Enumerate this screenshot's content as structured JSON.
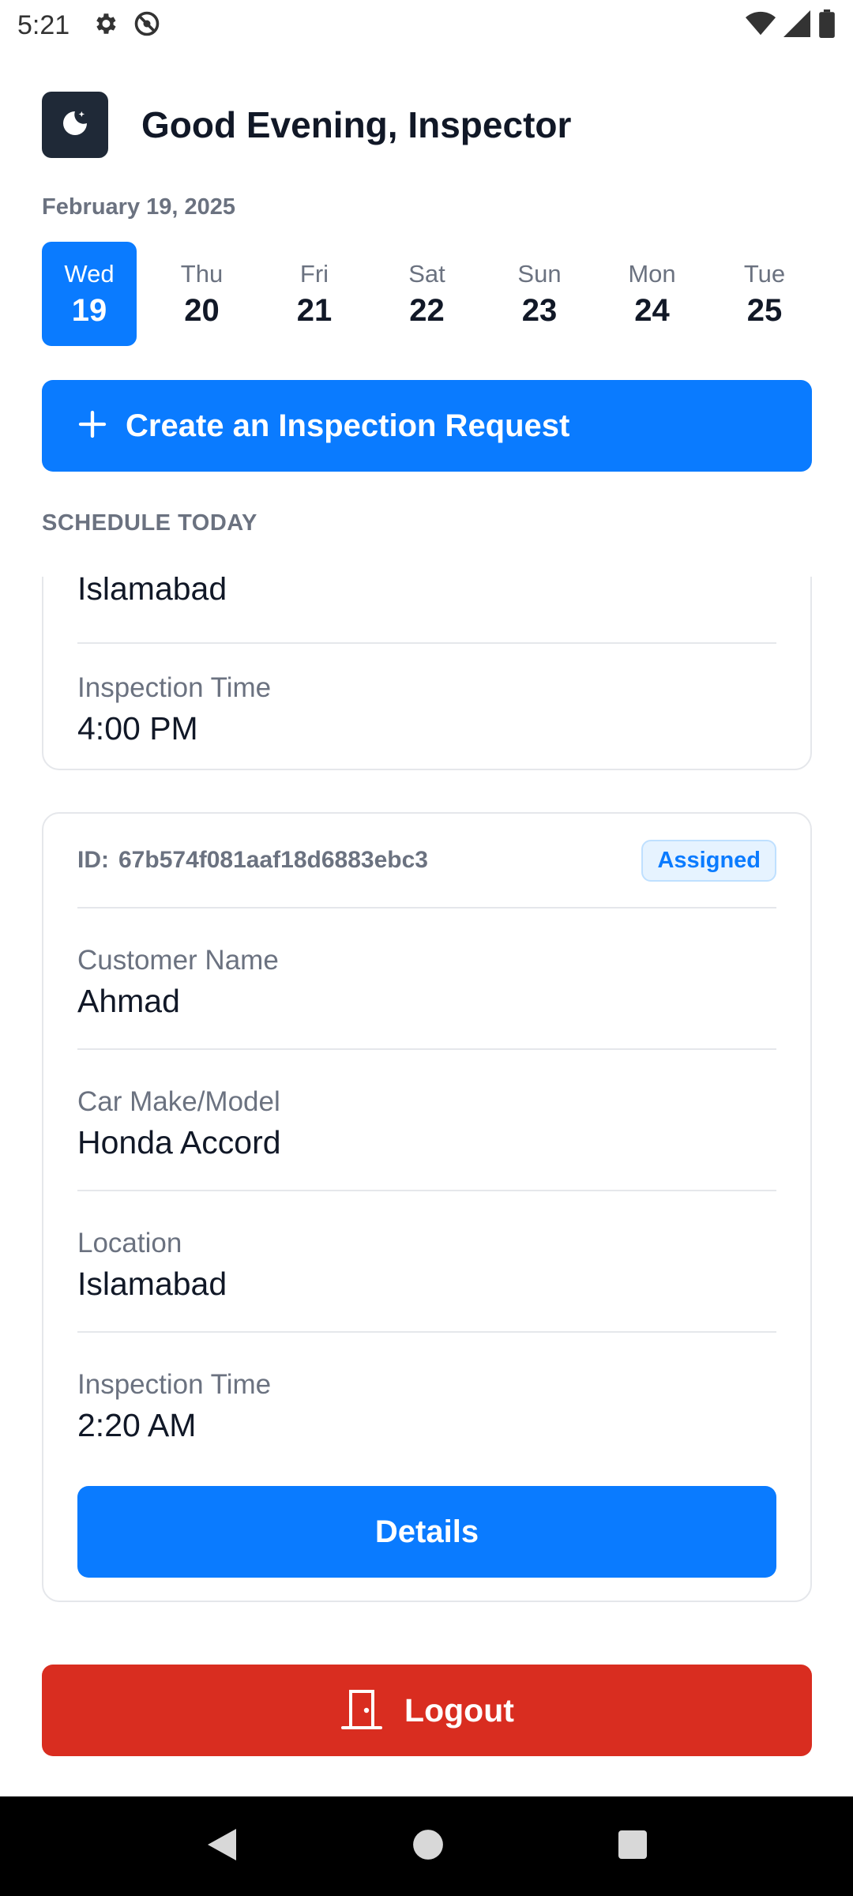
{
  "status": {
    "time": "5:21"
  },
  "header": {
    "greeting": "Good Evening, Inspector",
    "date": "February 19, 2025"
  },
  "week": [
    {
      "name": "Wed",
      "num": "19",
      "active": true
    },
    {
      "name": "Thu",
      "num": "20"
    },
    {
      "name": "Fri",
      "num": "21"
    },
    {
      "name": "Sat",
      "num": "22"
    },
    {
      "name": "Sun",
      "num": "23"
    },
    {
      "name": "Mon",
      "num": "24"
    },
    {
      "name": "Tue",
      "num": "25"
    }
  ],
  "create_button": {
    "label": "Create an Inspection Request"
  },
  "section": {
    "title": "SCHEDULE TODAY"
  },
  "card1": {
    "location_value": "Islamabad",
    "time_label": "Inspection Time",
    "time_value": "4:00 PM"
  },
  "card2": {
    "id_label": "ID:",
    "id_value": "67b574f081aaf18d6883ebc3",
    "status": "Assigned",
    "customer_label": "Customer Name",
    "customer_value": "Ahmad",
    "car_label": "Car Make/Model",
    "car_value": "Honda Accord",
    "location_label": "Location",
    "location_value": "Islamabad",
    "time_label": "Inspection Time",
    "time_value": "2:20 AM",
    "details_label": "Details"
  },
  "logout": {
    "label": "Logout"
  },
  "colors": {
    "primary": "#0a7bff",
    "danger": "#d92d20",
    "dark": "#1f2937"
  }
}
